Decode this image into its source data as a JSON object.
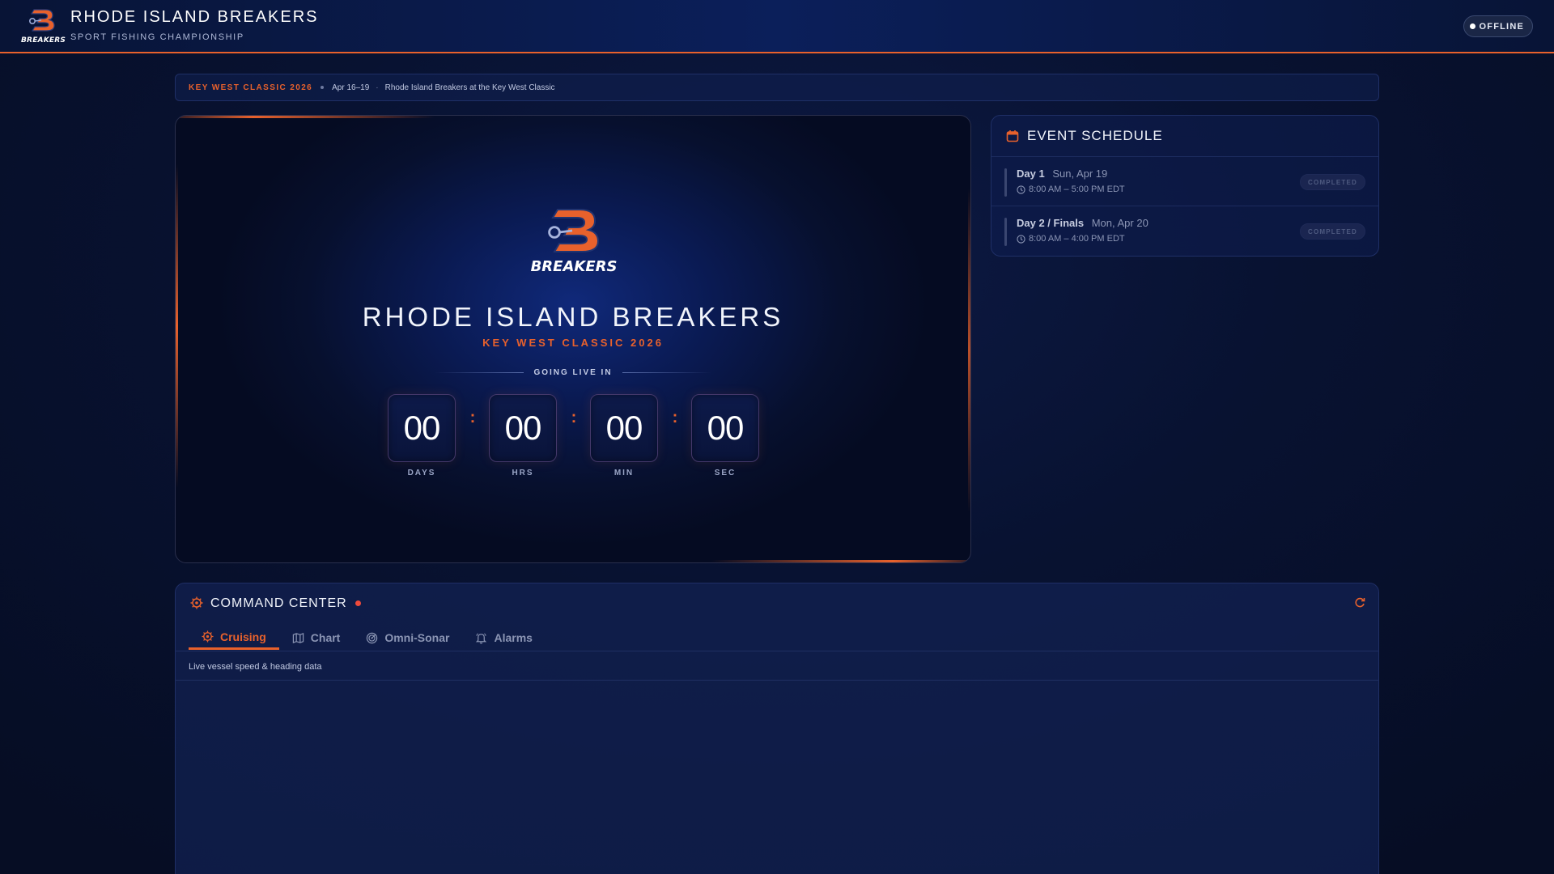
{
  "header": {
    "logo_text": "BREAKERS",
    "title": "RHODE ISLAND BREAKERS",
    "subtitle": "SPORT FISHING CHAMPIONSHIP",
    "status": "OFFLINE"
  },
  "event_strip": {
    "name": "KEY WEST CLASSIC 2026",
    "dates": "Apr 16–19",
    "separator": "·",
    "description": "Rhode Island Breakers at the Key West Classic"
  },
  "hero": {
    "logo_text": "BREAKERS",
    "title": "RHODE ISLAND BREAKERS",
    "subtitle": "KEY WEST CLASSIC 2026",
    "going_live_label": "GOING LIVE IN",
    "countdown": [
      {
        "value": "00",
        "label": "DAYS"
      },
      {
        "value": "00",
        "label": "HRS"
      },
      {
        "value": "00",
        "label": "MIN"
      },
      {
        "value": "00",
        "label": "SEC"
      }
    ],
    "colon": ":"
  },
  "schedule": {
    "title": "EVENT SCHEDULE",
    "items": [
      {
        "day": "Day 1",
        "date": "Sun, Apr 19",
        "time": "8:00 AM – 5:00 PM EDT",
        "status": "COMPLETED"
      },
      {
        "day": "Day 2 / Finals",
        "date": "Mon, Apr 20",
        "time": "8:00 AM – 4:00 PM EDT",
        "status": "COMPLETED"
      }
    ]
  },
  "command_center": {
    "title": "COMMAND CENTER",
    "tabs": [
      {
        "label": "Cruising",
        "icon": "helm-icon"
      },
      {
        "label": "Chart",
        "icon": "map-icon"
      },
      {
        "label": "Omni-Sonar",
        "icon": "sonar-icon"
      },
      {
        "label": "Alarms",
        "icon": "bell-icon"
      }
    ],
    "active_tab": "Cruising",
    "description": "Live vessel speed & heading data"
  },
  "colors": {
    "accent": "#e8612c",
    "background": "#081231",
    "panel": "#0f1e50",
    "live_dot": "#ef4a3b"
  }
}
